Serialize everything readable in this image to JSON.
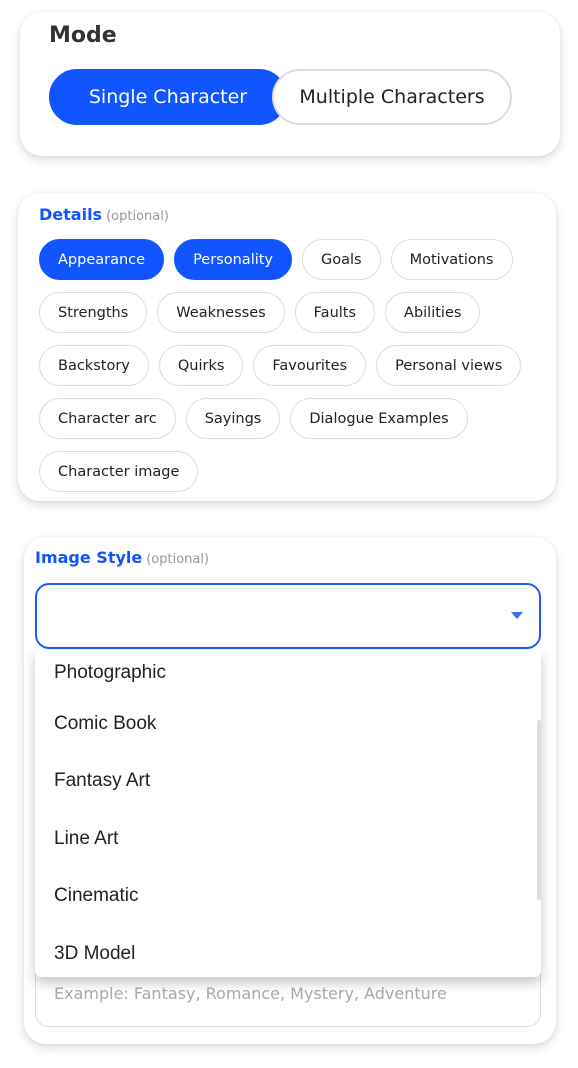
{
  "mode": {
    "title": "Mode",
    "options": [
      {
        "label": "Single Character",
        "selected": true
      },
      {
        "label": "Multiple Characters",
        "selected": false
      }
    ]
  },
  "details": {
    "title": "Details",
    "optional": "(optional)",
    "chips": [
      {
        "label": "Appearance",
        "selected": true
      },
      {
        "label": "Personality",
        "selected": true
      },
      {
        "label": "Goals",
        "selected": false
      },
      {
        "label": "Motivations",
        "selected": false
      },
      {
        "label": "Strengths",
        "selected": false
      },
      {
        "label": "Weaknesses",
        "selected": false
      },
      {
        "label": "Faults",
        "selected": false
      },
      {
        "label": "Abilities",
        "selected": false
      },
      {
        "label": "Backstory",
        "selected": false
      },
      {
        "label": "Quirks",
        "selected": false
      },
      {
        "label": "Favourites",
        "selected": false
      },
      {
        "label": "Personal views",
        "selected": false
      },
      {
        "label": "Character arc",
        "selected": false
      },
      {
        "label": "Sayings",
        "selected": false
      },
      {
        "label": "Dialogue Examples",
        "selected": false
      },
      {
        "label": "Character image",
        "selected": false
      }
    ]
  },
  "image_style": {
    "title": "Image Style",
    "optional": "(optional)",
    "value": "",
    "icon": "caret-down-icon",
    "options": [
      "Photographic",
      "Comic Book",
      "Fantasy Art",
      "Line Art",
      "Cinematic",
      "3D Model"
    ]
  },
  "genre": {
    "placeholder": "Example: Fantasy, Romance, Mystery, Adventure"
  },
  "colors": {
    "accent": "#1055ff"
  }
}
